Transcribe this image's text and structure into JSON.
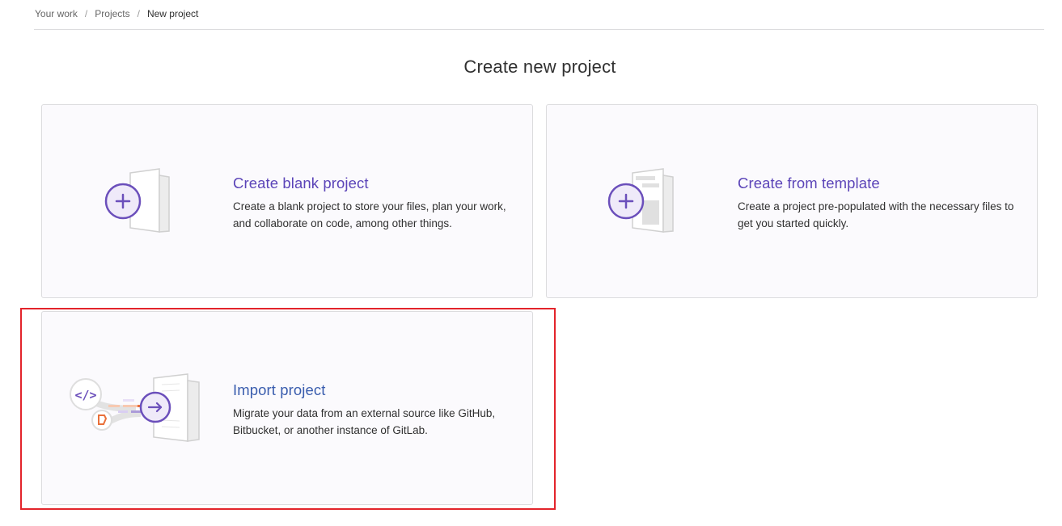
{
  "breadcrumb": {
    "items": [
      "Your work",
      "Projects",
      "New project"
    ],
    "separator": "/"
  },
  "page": {
    "title": "Create new project"
  },
  "cards": [
    {
      "title": "Create blank project",
      "description": "Create a blank project to store your files, plan your work, and collaborate on code, among other things.",
      "icon": "blank-project-icon"
    },
    {
      "title": "Create from template",
      "description": "Create a project pre-populated with the necessary files to get you started quickly.",
      "icon": "template-project-icon"
    },
    {
      "title": "Import project",
      "description": "Migrate your data from an external source like GitHub, Bitbucket, or another instance of GitLab.",
      "icon": "import-project-icon"
    }
  ],
  "colors": {
    "accent": "#5b44b8",
    "import_title": "#3a5dae",
    "highlight": "#e3242b",
    "orange": "#e9703a"
  }
}
